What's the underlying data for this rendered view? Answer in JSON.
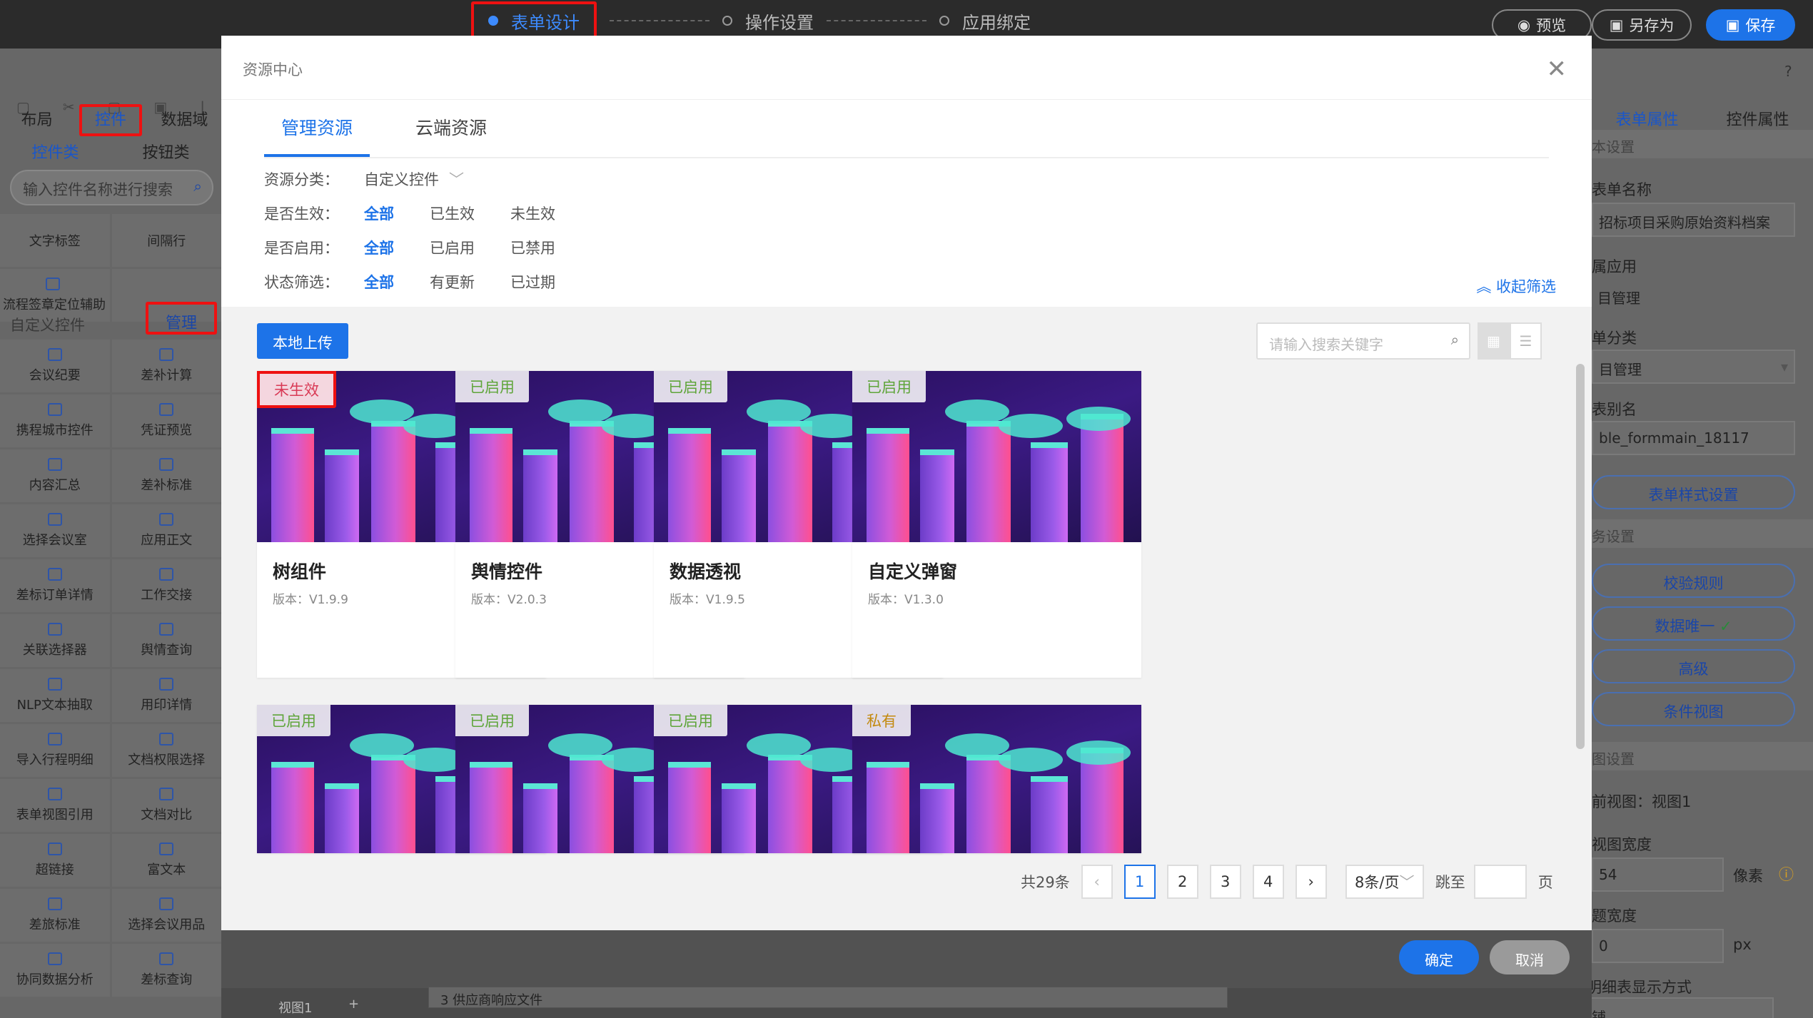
{
  "steps": [
    {
      "label": "表单设计",
      "active": true
    },
    {
      "label": "操作设置"
    },
    {
      "label": "应用绑定"
    }
  ],
  "top_buttons": {
    "preview": "预览",
    "save_as": "另存为",
    "save": "保存"
  },
  "left": {
    "tabs": [
      "布局",
      "控件",
      "数据域"
    ],
    "subtabs": [
      "控件类",
      "按钮类"
    ],
    "search_placeholder": "输入控件名称进行搜索",
    "top_items": [
      "文字标签",
      "间隔行",
      "流程签章定位辅助"
    ],
    "custom_section": "自定义控件",
    "manage_label": "管理",
    "items": [
      "会议纪要",
      "差补计算",
      "携程城市控件",
      "凭证预览",
      "内容汇总",
      "差补标准",
      "选择会议室",
      "应用正文",
      "差标订单详情",
      "工作交接",
      "关联选择器",
      "舆情查询",
      "NLP文本抽取",
      "用印详情",
      "导入行程明细",
      "文档权限选择",
      "表单视图引用",
      "文档对比",
      "超链接",
      "富文本",
      "差旅标准",
      "选择会议用品",
      "协同数据分析",
      "差标查询"
    ]
  },
  "right": {
    "tabs": [
      "表单属性",
      "控件属性"
    ],
    "sec_basic": "本设置",
    "form_name_label": "表单名称",
    "form_name_value": "招标项目采购原始资料档案",
    "app_label": "属应用",
    "app_value": "目管理",
    "category_label": "单分类",
    "category_value": "目管理",
    "table_alias_label": "表别名",
    "table_alias_value": "ble_formmain_18117",
    "style_btn": "表单样式设置",
    "sec_business": "务设置",
    "btn_validate": "校验规则",
    "btn_unique": "数据唯一",
    "btn_advanced": "高级",
    "btn_condition": "条件视图",
    "sec_view": "图设置",
    "current_view": "前视图：视图1",
    "view_width_label": "视图宽度",
    "view_width_value": "54",
    "view_width_unit": "像素",
    "col_width_label": "题宽度",
    "col_width_value": "0",
    "col_width_unit": "px",
    "detail_label": "多明细表显示方式",
    "detail_value": "平铺"
  },
  "modal": {
    "title": "资源中心",
    "tabs": [
      "管理资源",
      "云端资源"
    ],
    "filters": {
      "category_label": "资源分类：",
      "category_value": "自定义控件",
      "effective_label": "是否生效：",
      "effective_opts": [
        "全部",
        "已生效",
        "未生效"
      ],
      "enabled_label": "是否启用：",
      "enabled_opts": [
        "全部",
        "已启用",
        "已禁用"
      ],
      "status_label": "状态筛选：",
      "status_opts": [
        "全部",
        "有更新",
        "已过期"
      ]
    },
    "collapse": "收起筛选",
    "upload": "本地上传",
    "search_placeholder": "请输入搜索关键字",
    "cards": [
      {
        "badge": "未生效",
        "title": "树组件",
        "version": "版本：V1.9.9"
      },
      {
        "badge": "已启用",
        "title": "舆情控件",
        "version": "版本：V2.0.3"
      },
      {
        "badge": "已启用",
        "title": "数据透视",
        "version": "版本：V1.9.5"
      },
      {
        "badge": "已启用",
        "title": "自定义弹窗",
        "version": "版本：V1.3.0"
      },
      {
        "badge": "已启用",
        "title": "",
        "version": ""
      },
      {
        "badge": "已启用",
        "title": "",
        "version": ""
      },
      {
        "badge": "已启用",
        "title": "",
        "version": ""
      },
      {
        "badge": "私有",
        "title": "",
        "version": ""
      }
    ],
    "pager": {
      "total": "共29条",
      "pages": [
        "1",
        "2",
        "3",
        "4"
      ],
      "page_size": "8条/页",
      "jump": "跳至",
      "page_unit": "页"
    },
    "ok": "确定",
    "cancel": "取消"
  },
  "bottom": {
    "view_tab": "视图1",
    "row_text": "3   供应商响应文件"
  }
}
